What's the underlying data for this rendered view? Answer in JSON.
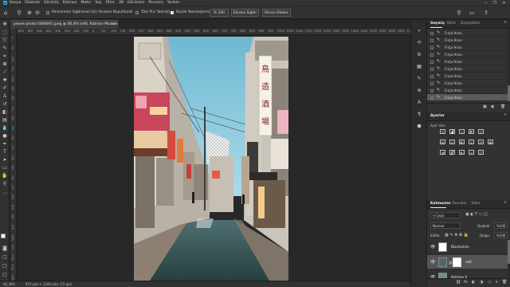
{
  "app": {
    "logo": "Ps"
  },
  "menu": [
    "Dosya",
    "Düzenle",
    "Görüntü",
    "Katman",
    "Metin",
    "Seç",
    "Filtre",
    "3B",
    "Görünüm",
    "Pencere",
    "Yardım"
  ],
  "window_controls": [
    "—",
    "❐",
    "✕"
  ],
  "options": {
    "resize_windows_label": "Pencereleri Sığdırmak İçin Yeniden Boyutlandır",
    "resize_windows_checked": false,
    "all_windows_label": "Tüm Pnc Yakınlşt",
    "all_windows_checked": false,
    "scrubby_zoom_label": "Küçük Yakınlaştırma",
    "scrubby_zoom_checked": true,
    "zoom_100": "% 100",
    "fit_screen": "Ekrana Sığdır",
    "fill_screen": "Ekranı Doldur"
  },
  "document": {
    "tab_title": "pexels-photo-5466891.jpeg @ 66,4% (edit, Katman Maskesi/8) *",
    "close": "×",
    "zoom_status": "66,38%",
    "size_status": "957 piks x 1280 piks (72 ppi)",
    "ruler_h": [
      "800",
      "850",
      "600",
      "650",
      "400",
      "450",
      "200",
      "250",
      "0",
      "50",
      "100",
      "150",
      "200",
      "250",
      "300",
      "350",
      "400",
      "450",
      "500",
      "550",
      "600",
      "650",
      "700",
      "750",
      "800",
      "850",
      "900",
      "950",
      "1000",
      "1050",
      "1100",
      "1150",
      "1200",
      "1250",
      "1300",
      "1350",
      "1400",
      "1450",
      "1500",
      "1550",
      "1600",
      "1650",
      "1700"
    ],
    "ruler_v": [
      "0",
      "50",
      "100",
      "150",
      "200",
      "250",
      "300",
      "350",
      "400",
      "450",
      "500",
      "550",
      "600",
      "650",
      "700",
      "750",
      "800",
      "850",
      "900",
      "950",
      "1000",
      "1050",
      "1100",
      "1150",
      "1200"
    ]
  },
  "photo": {
    "sign_chars": [
      "鳥",
      "造",
      "酒",
      "場"
    ]
  },
  "history": {
    "tabs": [
      "Geçmiş",
      "Renk",
      "Degradeler"
    ],
    "active_tab": "Geçmiş",
    "items": [
      "Fırça Aracı",
      "Fırça Aracı",
      "Fırça Aracı",
      "Fırça Aracı",
      "Fırça Aracı",
      "Fırça Aracı",
      "Fırça Aracı",
      "Fırça Aracı",
      "Fırça Aracı",
      "Fırça Aracı"
    ],
    "selected_index": 9
  },
  "adjustments": {
    "tab": "Ayarlar",
    "add_label": "Ayar ekle"
  },
  "layers": {
    "tabs": [
      "Katmanlar",
      "Kanallar",
      "Yollar"
    ],
    "active_tab": "Katmanlar",
    "filter_kind": "Çeşit",
    "blend_mode": "Normal",
    "opacity_label": "Opaklık:",
    "opacity_value": "%100",
    "lock_label": "Kilitle:",
    "fill_label": "Dolgu:",
    "fill_value": "%100",
    "items": [
      {
        "name": "Blackwhite",
        "selected": false,
        "has_mask": false
      },
      {
        "name": "edit",
        "selected": true,
        "has_mask": true
      },
      {
        "name": "Katman 0",
        "selected": false,
        "has_mask": false
      }
    ],
    "footer_icons": [
      "⛓",
      "fx",
      "◐",
      "◑",
      "▭",
      "+",
      "🗑"
    ]
  },
  "colors": {
    "ui_bg": "#323232",
    "canvas_bg": "#282828",
    "accent": "#31a8ff",
    "photo_sky": "#7ec3d8",
    "photo_road": "#2f4f52"
  }
}
